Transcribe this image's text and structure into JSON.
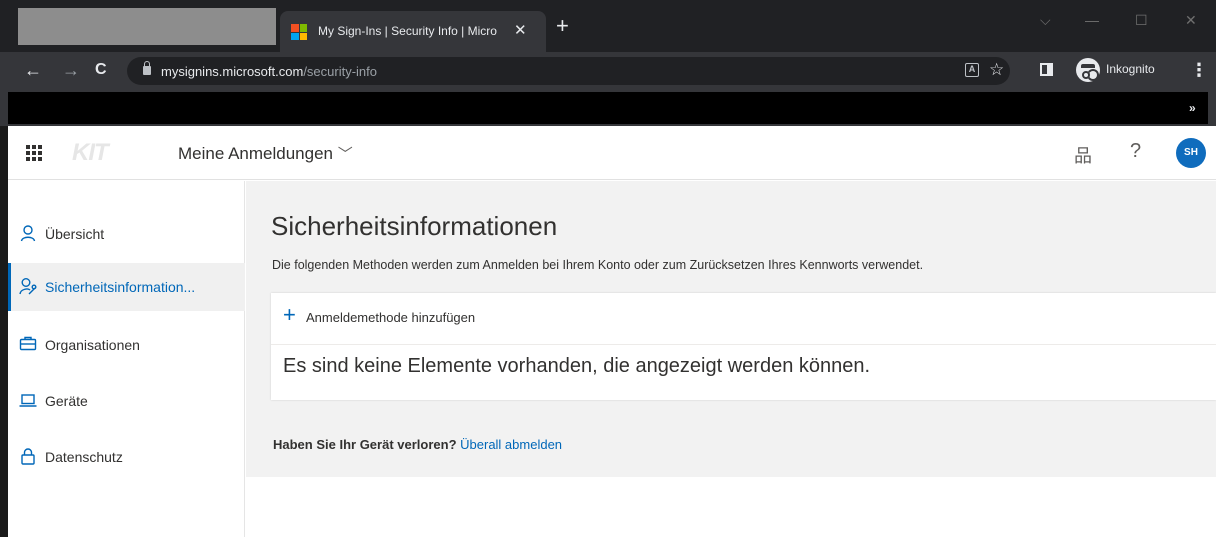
{
  "browser": {
    "tab_title": "My Sign-Ins | Security Info | Micro",
    "tab_close": "✕",
    "new_tab": "+",
    "url_host": "mysignins.microsoft.com",
    "url_path": "/security-info",
    "profile_label": "Inkognito",
    "back": "←",
    "forward": "→",
    "reload": "C",
    "star": "☆",
    "menu": "⋮",
    "bookmarks_chevron": "»",
    "win_minimize": "—",
    "win_maximize": "☐",
    "win_close": "✕",
    "win_dropdown": "⌵",
    "logo_colors": [
      "#f25022",
      "#7fba00",
      "#00a4ef",
      "#ffb900"
    ]
  },
  "header": {
    "logo": "KIT",
    "app_title": "Meine Anmeldungen",
    "dropdown": "﹀",
    "help": "?",
    "avatar_initials": "SH",
    "org_symbol": "品"
  },
  "sidebar": {
    "items": [
      {
        "label": "Übersicht",
        "icon": "person-icon"
      },
      {
        "label": "Sicherheitsinformation...",
        "icon": "person-key-icon",
        "active": true
      },
      {
        "label": "Organisationen",
        "icon": "briefcase-icon"
      },
      {
        "label": "Geräte",
        "icon": "laptop-icon"
      },
      {
        "label": "Datenschutz",
        "icon": "lock-icon"
      }
    ]
  },
  "main": {
    "title": "Sicherheitsinformationen",
    "description": "Die folgenden Methoden werden zum Anmelden bei Ihrem Konto oder zum Zurücksetzen Ihres Kennworts verwendet.",
    "add_method_symbol": "+",
    "add_method_label": "Anmeldemethode hinzufügen",
    "empty_message": "Es sind keine Elemente vorhanden, die angezeigt werden können.",
    "lost_device_question": "Haben Sie Ihr Gerät verloren?",
    "sign_out_everywhere": "Überall abmelden"
  },
  "colors": {
    "accent": "#0067b8",
    "avatar": "#0f6cbd"
  }
}
